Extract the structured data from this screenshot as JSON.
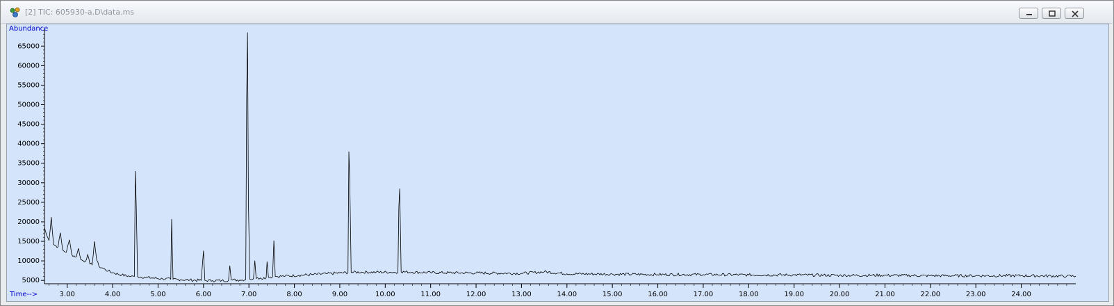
{
  "window": {
    "title": "[2] TIC: 605930-a.D\\data.ms",
    "icon": "chemstation-molecule-icon",
    "buttons": [
      "minimize",
      "restore",
      "close"
    ]
  },
  "colors": {
    "plot_background": "#d4e4fa",
    "trace": "#000000",
    "axis_label": "#0000cc",
    "title_text": "#8e96a0"
  },
  "chart_data": {
    "type": "line",
    "ylabel": "Abundance",
    "xlabel": "Time-->",
    "xlim": [
      2.5,
      25.2
    ],
    "ylim": [
      4500,
      69500
    ],
    "grid": false,
    "legend": "none",
    "x_ticks": [
      "3.00",
      "4.00",
      "5.00",
      "6.00",
      "7.00",
      "8.00",
      "9.00",
      "10.00",
      "11.00",
      "12.00",
      "13.00",
      "14.00",
      "15.00",
      "16.00",
      "17.00",
      "18.00",
      "19.00",
      "20.00",
      "21.00",
      "22.00",
      "23.00",
      "24.00"
    ],
    "y_ticks": [
      "5000",
      "10000",
      "15000",
      "20000",
      "25000",
      "30000",
      "35000",
      "40000",
      "45000",
      "50000",
      "55000",
      "60000",
      "65000"
    ],
    "series": [
      {
        "values": [
          [
            2.5,
            18500
          ],
          [
            2.55,
            16500
          ],
          [
            2.6,
            15200
          ],
          [
            2.65,
            21200
          ],
          [
            2.7,
            14200
          ],
          [
            2.8,
            13600
          ],
          [
            2.85,
            17200
          ],
          [
            2.9,
            12800
          ],
          [
            2.98,
            12200
          ],
          [
            3.05,
            15400
          ],
          [
            3.1,
            11600
          ],
          [
            3.2,
            11000
          ],
          [
            3.25,
            13200
          ],
          [
            3.3,
            10300
          ],
          [
            3.4,
            9800
          ],
          [
            3.45,
            11600
          ],
          [
            3.5,
            9200
          ],
          [
            3.55,
            9000
          ],
          [
            3.6,
            15000
          ],
          [
            3.65,
            10200
          ],
          [
            3.7,
            8600
          ],
          [
            3.8,
            8000
          ],
          [
            3.9,
            7400
          ],
          [
            4.0,
            7000
          ],
          [
            4.2,
            6400
          ],
          [
            4.4,
            6000
          ],
          [
            4.48,
            6000
          ],
          [
            4.5,
            33000
          ],
          [
            4.52,
            24000
          ],
          [
            4.55,
            6000
          ],
          [
            4.7,
            5800
          ],
          [
            4.9,
            5600
          ],
          [
            5.1,
            5400
          ],
          [
            5.28,
            5300
          ],
          [
            5.3,
            20700
          ],
          [
            5.33,
            5300
          ],
          [
            5.5,
            5200
          ],
          [
            5.7,
            5100
          ],
          [
            5.95,
            5000
          ],
          [
            6.0,
            12600
          ],
          [
            6.03,
            5000
          ],
          [
            6.2,
            4950
          ],
          [
            6.4,
            4950
          ],
          [
            6.55,
            5000
          ],
          [
            6.58,
            8800
          ],
          [
            6.61,
            5100
          ],
          [
            6.8,
            5100
          ],
          [
            6.93,
            5200
          ],
          [
            6.95,
            51500
          ],
          [
            6.97,
            68500
          ],
          [
            6.99,
            24500
          ],
          [
            7.02,
            5300
          ],
          [
            7.1,
            5400
          ],
          [
            7.13,
            10100
          ],
          [
            7.16,
            5500
          ],
          [
            7.25,
            5600
          ],
          [
            7.38,
            5700
          ],
          [
            7.4,
            9800
          ],
          [
            7.43,
            5800
          ],
          [
            7.52,
            5900
          ],
          [
            7.55,
            15200
          ],
          [
            7.58,
            6000
          ],
          [
            7.8,
            6100
          ],
          [
            8.1,
            6300
          ],
          [
            8.4,
            6500
          ],
          [
            8.7,
            6700
          ],
          [
            9.0,
            6900
          ],
          [
            9.18,
            7000
          ],
          [
            9.2,
            38000
          ],
          [
            9.22,
            30700
          ],
          [
            9.25,
            7100
          ],
          [
            9.5,
            7100
          ],
          [
            9.8,
            7100
          ],
          [
            10.1,
            7100
          ],
          [
            10.28,
            7100
          ],
          [
            10.3,
            23800
          ],
          [
            10.32,
            28500
          ],
          [
            10.35,
            7200
          ],
          [
            10.6,
            7100
          ],
          [
            11.0,
            7000
          ],
          [
            12.0,
            6900
          ],
          [
            13.0,
            6800
          ],
          [
            13.5,
            7200
          ],
          [
            14.0,
            6700
          ],
          [
            15.0,
            6600
          ],
          [
            16.0,
            6500
          ],
          [
            17.0,
            6500
          ],
          [
            18.0,
            6400
          ],
          [
            19.0,
            6400
          ],
          [
            20.0,
            6300
          ],
          [
            21.0,
            6300
          ],
          [
            22.0,
            6200
          ],
          [
            23.0,
            6200
          ],
          [
            24.0,
            6200
          ],
          [
            25.0,
            6100
          ],
          [
            25.2,
            6100
          ]
        ]
      }
    ]
  }
}
